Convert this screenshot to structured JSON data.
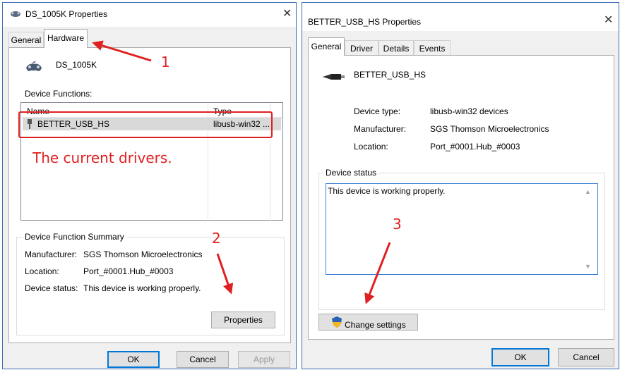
{
  "left_window": {
    "title": "DS_1005K Properties",
    "tabs": [
      "General",
      "Hardware"
    ],
    "device_name": "DS_1005K",
    "device_functions_label": "Device Functions:",
    "columns": [
      "Name",
      "Type"
    ],
    "rows": [
      {
        "name": "BETTER_USB_HS",
        "type": "libusb-win32 ..."
      }
    ],
    "summary": {
      "title": "Device Function Summary",
      "fields": [
        {
          "label": "Manufacturer:",
          "value": "SGS Thomson Microelectronics"
        },
        {
          "label": "Location:",
          "value": "Port_#0001.Hub_#0003"
        },
        {
          "label": "Device status:",
          "value": "This device is working properly."
        }
      ],
      "properties_button": "Properties"
    },
    "buttons": {
      "ok": "OK",
      "cancel": "Cancel",
      "apply": "Apply"
    }
  },
  "right_window": {
    "title": "BETTER_USB_HS Properties",
    "tabs": [
      "General",
      "Driver",
      "Details",
      "Events"
    ],
    "device_name": "BETTER_USB_HS",
    "fields": [
      {
        "label": "Device type:",
        "value": "libusb-win32 devices"
      },
      {
        "label": "Manufacturer:",
        "value": "SGS Thomson Microelectronics"
      },
      {
        "label": "Location:",
        "value": "Port_#0001.Hub_#0003"
      }
    ],
    "device_status_label": "Device status",
    "device_status_text": "This device is working properly.",
    "change_settings_button": "Change settings",
    "buttons": {
      "ok": "OK",
      "cancel": "Cancel"
    }
  },
  "annotations": {
    "step1": "1",
    "step2": "2",
    "step3": "3",
    "note": "The current drivers.",
    "color": "#e02020"
  }
}
